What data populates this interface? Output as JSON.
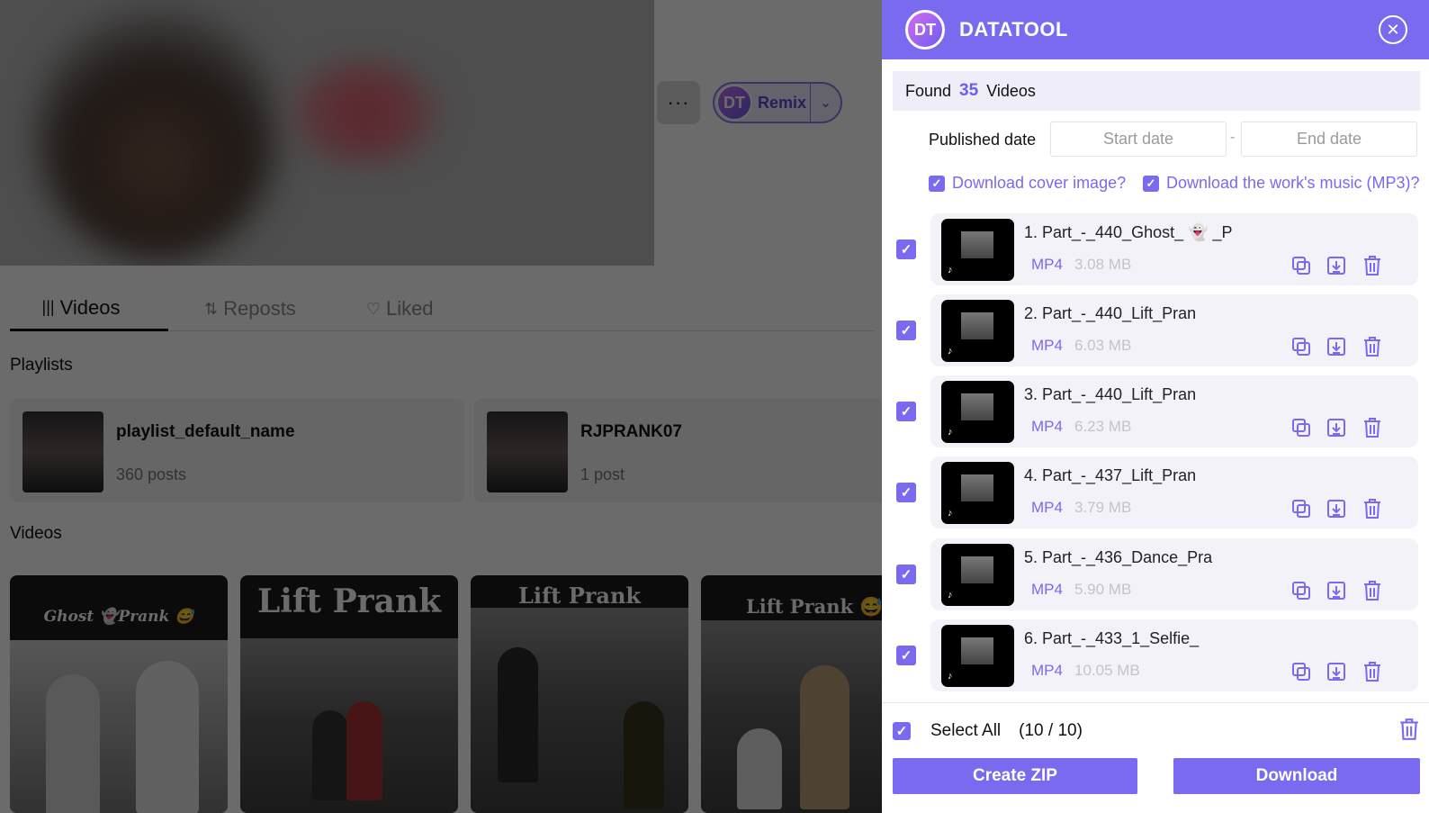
{
  "background_page": {
    "more_button_label": "···",
    "remix": {
      "logo": "DT",
      "label": "Remix",
      "caret": "⌄"
    },
    "tabs": [
      {
        "icon": "|||",
        "label": "Videos"
      },
      {
        "icon": "⇅",
        "label": "Reposts"
      },
      {
        "icon": "♡",
        "label": "Liked"
      }
    ],
    "playlists_title": "Playlists",
    "playlists": [
      {
        "name": "playlist_default_name",
        "count": "360 posts"
      },
      {
        "name": "RJPRANK07",
        "count": "1 post"
      }
    ],
    "videos_title": "Videos",
    "video_cards": [
      {
        "title": "Ghost 👻Prank 😅"
      },
      {
        "title": "Lift Prank"
      },
      {
        "title": "Lift Prank"
      },
      {
        "title": "Lift Prank 😅"
      }
    ]
  },
  "panel": {
    "logo": "DT",
    "brand": "DATATOOL",
    "close_icon": "✕",
    "found_prefix": "Found",
    "found_count": "35",
    "found_suffix": "Videos",
    "published_date_label": "Published date",
    "start_date_placeholder": "Start date",
    "end_date_placeholder": "End date",
    "date_separator": "-",
    "option_cover": "Download cover image?",
    "option_music": "Download the work's music (MP3)?",
    "check_glyph": "✓",
    "items": [
      {
        "title": "1. Part_-_440_Ghost_ 👻 _P",
        "format": "MP4",
        "size": "3.08 MB"
      },
      {
        "title": "2. Part_-_440_Lift_Pran",
        "format": "MP4",
        "size": "6.03 MB"
      },
      {
        "title": "3. Part_-_440_Lift_Pran",
        "format": "MP4",
        "size": "6.23 MB"
      },
      {
        "title": "4. Part_-_437_Lift_Pran",
        "format": "MP4",
        "size": "3.79 MB"
      },
      {
        "title": "5. Part_-_436_Dance_Pra",
        "format": "MP4",
        "size": "5.90 MB"
      },
      {
        "title": "6. Part_-_433_1_Selfie_",
        "format": "MP4",
        "size": "10.05 MB"
      }
    ],
    "select_all_label": "Select All",
    "select_all_count": "(10 / 10)",
    "create_zip_label": "Create ZIP",
    "download_label": "Download",
    "accent_color": "#7a6af0"
  }
}
